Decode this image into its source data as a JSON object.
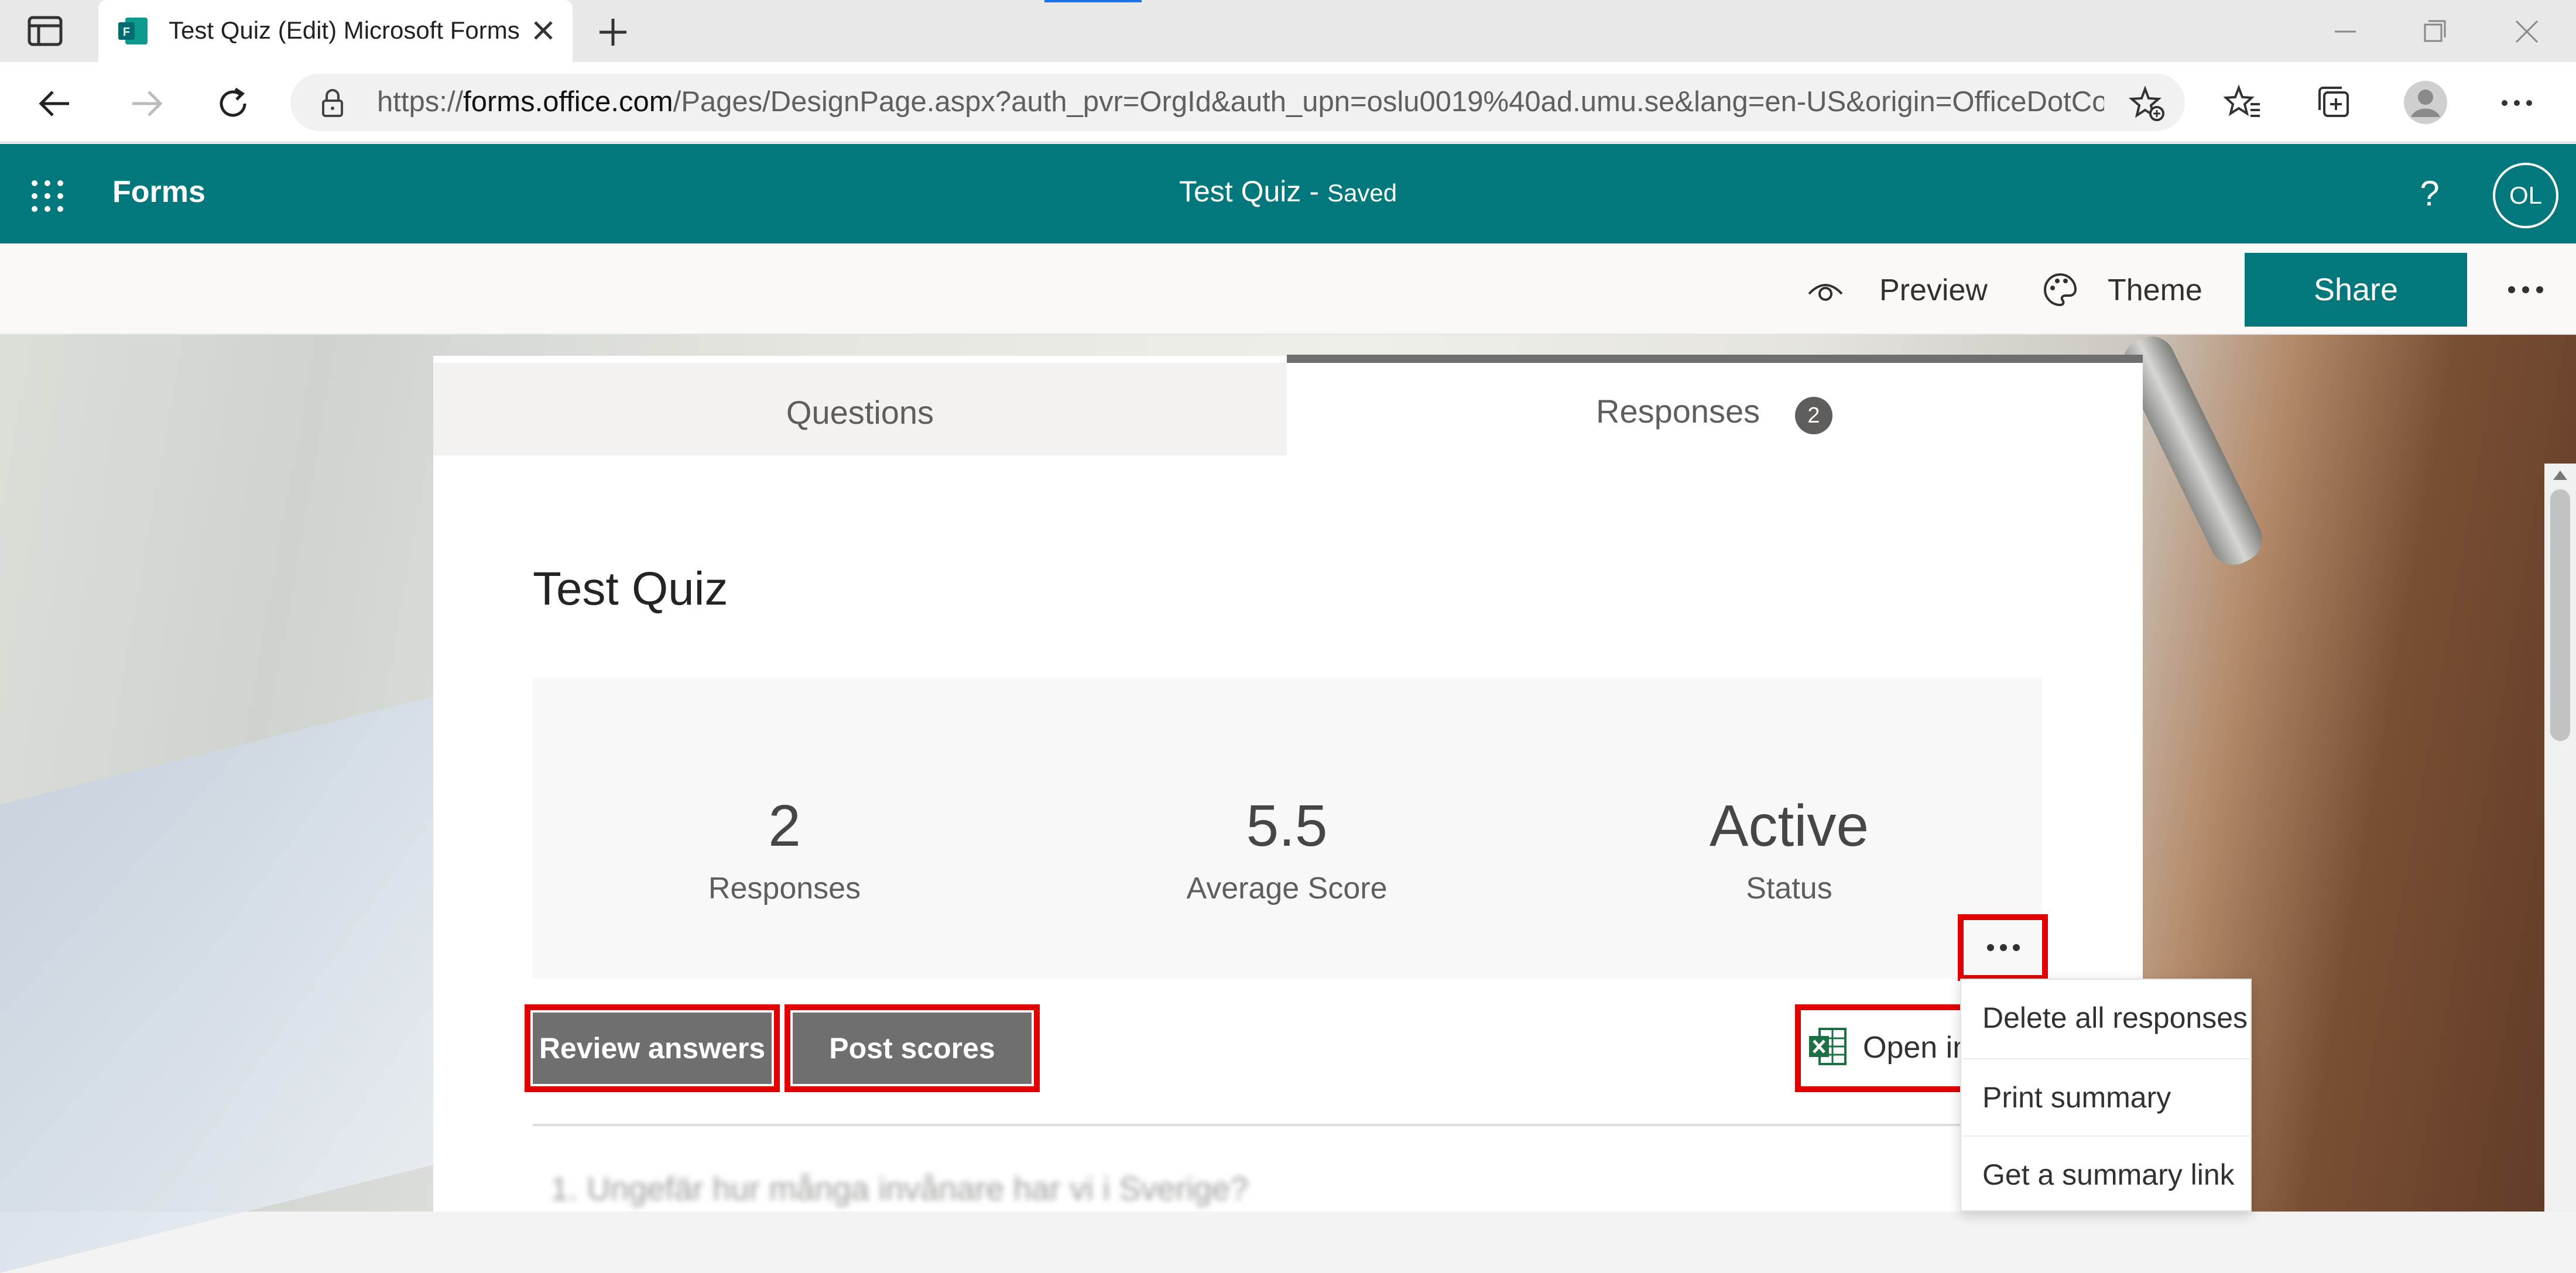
{
  "browser": {
    "tab_title": "Test Quiz (Edit) Microsoft Forms",
    "url_prefix": "https://",
    "url_host": "forms.office.com",
    "url_rest": "/Pages/DesignPage.aspx?auth_pvr=OrgId&auth_upn=oslu0019%40ad.umu.se&lang=en-US&origin=OfficeDotCo..."
  },
  "header": {
    "app_name": "Forms",
    "doc_title": "Test Quiz",
    "separator": "-",
    "status": "Saved",
    "help": "?",
    "avatar_initials": "OL"
  },
  "commands": {
    "preview": "Preview",
    "theme": "Theme",
    "share": "Share"
  },
  "tabs": {
    "questions": "Questions",
    "responses": "Responses",
    "responses_count": "2"
  },
  "quiz": {
    "title": "Test Quiz",
    "stats": [
      {
        "value": "2",
        "label": "Responses"
      },
      {
        "value": "5.5",
        "label": "Average Score"
      },
      {
        "value": "Active",
        "label": "Status"
      }
    ],
    "review_answers": "Review answers",
    "post_scores": "Post scores",
    "open_in_excel": "Open in",
    "question_1": "1.  Ungefär hur många invånare har vi i Sverige?"
  },
  "menu": {
    "items": [
      "Delete all responses",
      "Print summary",
      "Get a summary link"
    ]
  },
  "colors": {
    "forms_teal": "#03787c",
    "highlight_red": "#e00000",
    "button_gray": "#6f6f6f"
  }
}
